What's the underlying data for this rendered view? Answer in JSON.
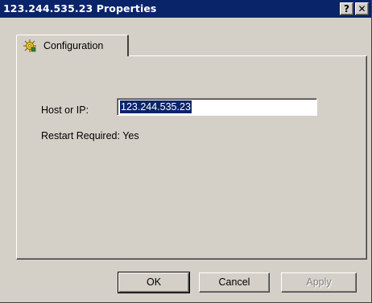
{
  "window": {
    "title": "123.244.535.23 Properties",
    "help_glyph": "?",
    "close_glyph": "✕"
  },
  "tabs": [
    {
      "label": "Configuration",
      "icon": "gear-star-icon",
      "selected": true
    }
  ],
  "form": {
    "host_label": "Host or IP:",
    "host_value": "123.244.535.23",
    "restart_text": "Restart Required: Yes"
  },
  "buttons": {
    "ok": "OK",
    "cancel": "Cancel",
    "apply": "Apply"
  },
  "colors": {
    "titlebar": "#0a246a",
    "face": "#d4d0c8",
    "selection": "#0a246a"
  }
}
